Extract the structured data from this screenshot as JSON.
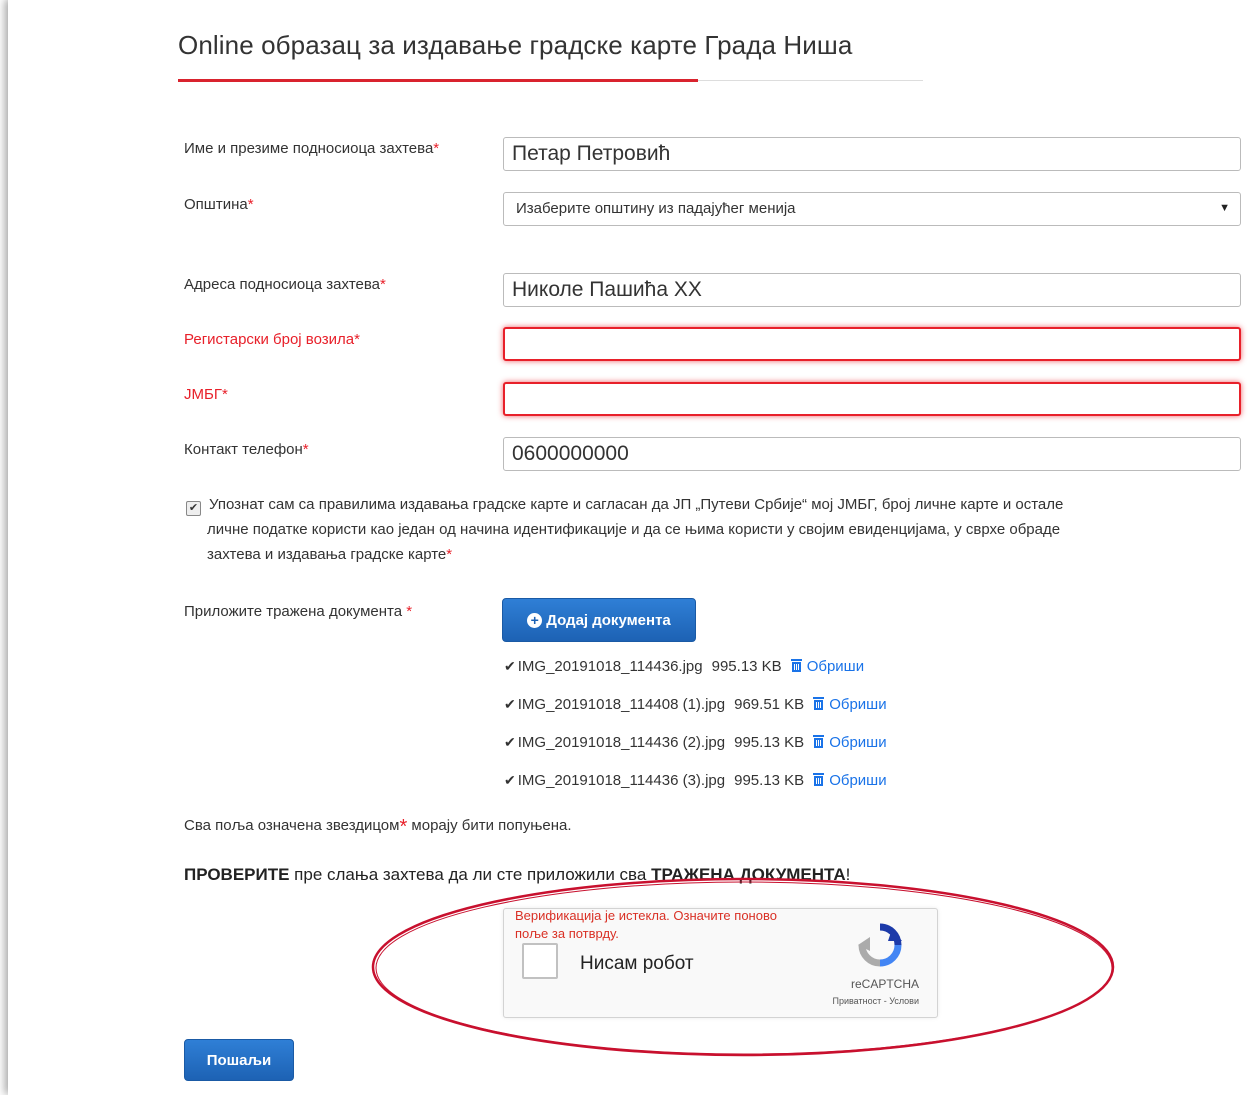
{
  "page": {
    "title": "Online образац за издавање градске карте Града Ниша"
  },
  "form": {
    "name": {
      "label": "Име и презиме подносиоца захтева",
      "required_mark": "*",
      "value": "Петар Петровић"
    },
    "municipality": {
      "label": "Општина",
      "required_mark": "*",
      "selected": "Изаберите општину из падајућег менија"
    },
    "address": {
      "label": "Адреса подносиоца захтева",
      "required_mark": "*",
      "value": "Николе Пашића XX"
    },
    "registration": {
      "label": "Регистарски број возила",
      "required_mark": "*",
      "value": ""
    },
    "jmbg": {
      "label": "ЈМБГ",
      "required_mark": "*",
      "value": ""
    },
    "phone": {
      "label": "Контакт телефон",
      "required_mark": "*",
      "value": "0600000000"
    },
    "consent": {
      "checked": true,
      "line1": "Упознат сам са правилима издавања градске карте и сагласан да ЈП „Путеви Србије“ мој ЈМБГ, број личне карте и остале",
      "line2": "личне податке користи као један од начина идентификације и да се њима користи у својим евиденцијама, у сврхе обраде",
      "line3": "захтева и издавања градске карте",
      "required_mark": "*"
    },
    "documents": {
      "label": "Приложите тражена документа",
      "required_mark": "*",
      "add_button": "Додај документа",
      "delete_label": "Обриши",
      "files": [
        {
          "name": "IMG_20191018_114436.jpg",
          "size": "995.13 KB"
        },
        {
          "name": "IMG_20191018_114408 (1).jpg",
          "size": "969.51 KB"
        },
        {
          "name": "IMG_20191018_114436 (2).jpg",
          "size": "995.13 KB"
        },
        {
          "name": "IMG_20191018_114436 (3).jpg",
          "size": "995.13 KB"
        }
      ]
    },
    "required_note": {
      "before": "Сва поља означена звездицом",
      "star": "*",
      "after": " морају бити попуњена."
    },
    "check_warning": {
      "bold1": "ПРОВЕРИТЕ",
      "text": " пре слања захтева да ли сте приложили сва ",
      "bold2": "ТРАЖЕНА ДОКУМЕНТА",
      "end": "!"
    },
    "recaptcha": {
      "expired_msg": "Верификација је истекла. Означите поново поље за потврду.",
      "label": "Нисам робот",
      "brand": "reCAPTCHA",
      "terms": "Приватност - Услови"
    },
    "submit": "Пошаљи"
  },
  "colors": {
    "accent_red": "#d9232e",
    "error_red": "#e8202a",
    "button_blue": "#1d62b4",
    "link_blue": "#1a73e8"
  }
}
